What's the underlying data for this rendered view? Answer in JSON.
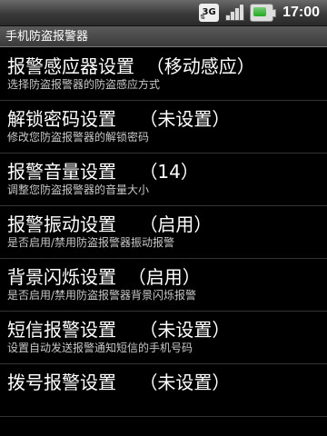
{
  "status_bar": {
    "network_icon": "3g-icon",
    "network_label": "3G",
    "signal_icon": "signal-strength-icon",
    "battery_icon": "battery-icon",
    "time": "17:00"
  },
  "app": {
    "title": "手机防盗报警器"
  },
  "settings": {
    "items": [
      {
        "title": "报警感应器设置",
        "value": "（移动感应）",
        "summary": "选择防盗报警器的防盗感应方式"
      },
      {
        "title": "解锁密码设置",
        "value": "（未设置）",
        "summary": "修改您防盗报警器的解锁密码"
      },
      {
        "title": "报警音量设置",
        "value": "（14）",
        "summary": "调整您防盗报警器的音量大小"
      },
      {
        "title": "报警振动设置",
        "value": "（启用）",
        "summary": "是否启用/禁用防盗报警器振动报警"
      },
      {
        "title": "背景闪烁设置",
        "value": "（启用）",
        "summary": "是否启用/禁用防盗报警器背景闪烁报警"
      },
      {
        "title": "短信报警设置",
        "value": "（未设置）",
        "summary": "设置自动发送报警通知短信的手机号码"
      },
      {
        "title": "拨号报警设置",
        "value": "（未设置）",
        "summary": ""
      }
    ]
  }
}
